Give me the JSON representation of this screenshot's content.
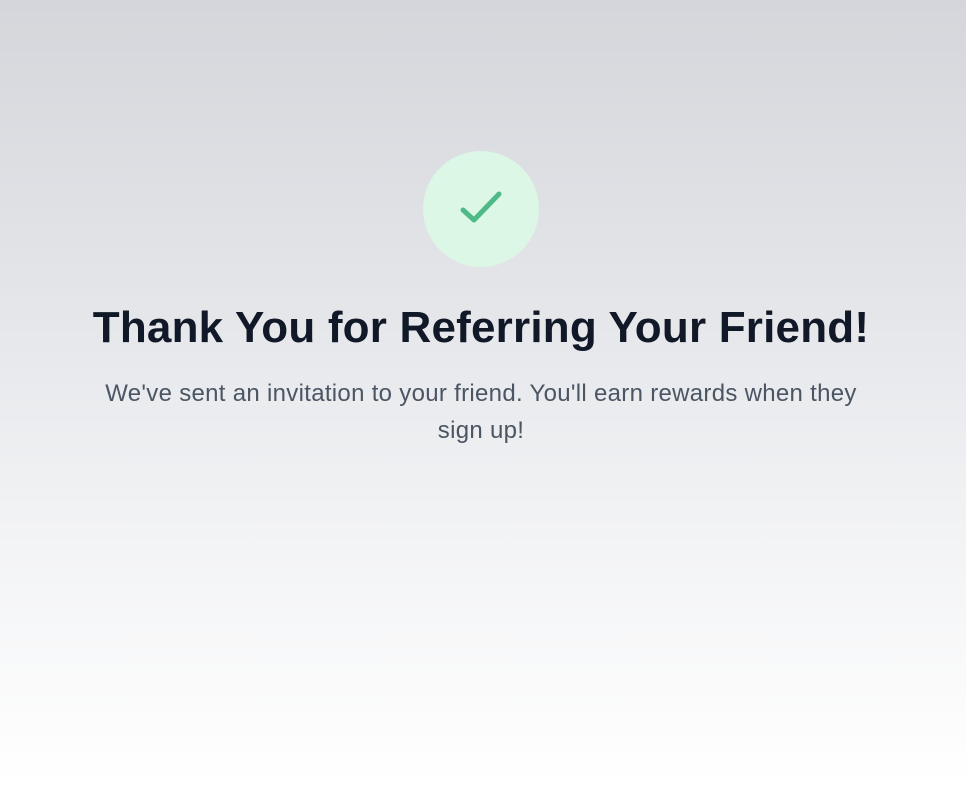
{
  "success": {
    "icon": "checkmark-icon",
    "title": "Thank You for Referring Your Friend!",
    "message": "We've sent an invitation to your friend. You'll earn rewards when they sign up!"
  },
  "colors": {
    "icon_background": "#dcf7e6",
    "icon_check": "#4fb987",
    "title_text": "#111827",
    "message_text": "#4b5563"
  }
}
